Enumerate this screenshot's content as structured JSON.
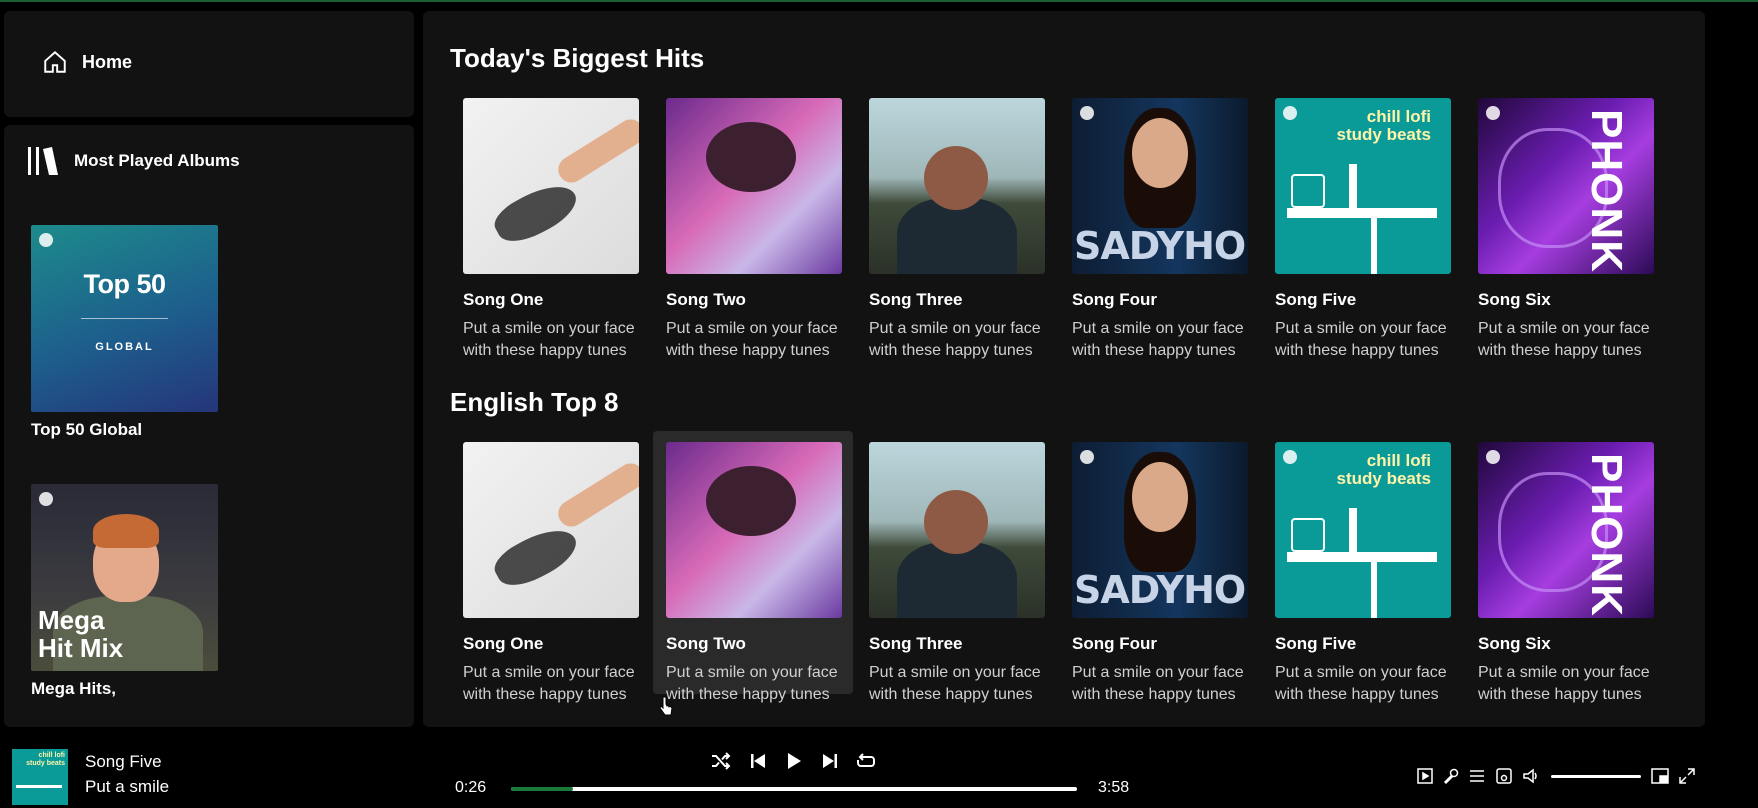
{
  "sidebar": {
    "home_label": "Home",
    "library_label": "Most Played Albums",
    "albums": [
      {
        "name": "Top 50 Global",
        "cover_big": "Top 50",
        "cover_small": "GLOBAL"
      },
      {
        "name": "Mega Hits,",
        "cover_text": "Mega\nHit Mix"
      }
    ]
  },
  "sections": [
    {
      "title": "Today's Biggest Hits",
      "cards": [
        {
          "title": "Song One",
          "desc": "Put a smile on your face with these happy tunes"
        },
        {
          "title": "Song Two",
          "desc": "Put a smile on your face with these happy tunes"
        },
        {
          "title": "Song Three",
          "desc": "Put a smile on your face with these happy tunes"
        },
        {
          "title": "Song Four",
          "desc": "Put a smile on your face with these happy tunes"
        },
        {
          "title": "Song Five",
          "desc": "Put a smile on your face with these happy tunes"
        },
        {
          "title": "Song Six",
          "desc": "Put a smile on your face with these happy tunes"
        }
      ]
    },
    {
      "title": "English Top 8",
      "cards": [
        {
          "title": "Song One",
          "desc": "Put a smile on your face with these happy tunes"
        },
        {
          "title": "Song Two",
          "desc": "Put a smile on your face with these happy tunes"
        },
        {
          "title": "Song Three",
          "desc": "Put a smile on your face with these happy tunes"
        },
        {
          "title": "Song Four",
          "desc": "Put a smile on your face with these happy tunes"
        },
        {
          "title": "Song Five",
          "desc": "Put a smile on your face with these happy tunes"
        },
        {
          "title": "Song Six",
          "desc": "Put a smile on your face with these happy tunes"
        }
      ]
    }
  ],
  "art_text": {
    "sady": "SADYHOUR",
    "chill": "chill lofi\nstudy beats",
    "phonk": "PHONK"
  },
  "player": {
    "track_title": "Song Five",
    "track_subtitle": "Put a smile",
    "current_time": "0:26",
    "total_time": "3:58",
    "progress_fraction": 0.11,
    "volume_fraction": 1.0,
    "now_playing_art_text": "chill lofi\nstudy beats"
  },
  "colors": {
    "accent": "#1a7a3a",
    "panel": "#121212",
    "background": "#000000"
  }
}
